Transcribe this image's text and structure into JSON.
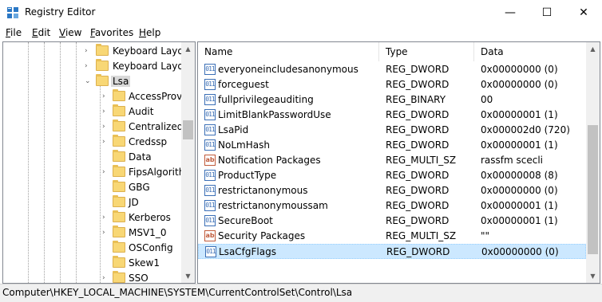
{
  "window": {
    "title": "Registry Editor",
    "minimize_glyph": "—",
    "maximize_glyph": "☐",
    "close_glyph": "✕"
  },
  "menu": [
    {
      "label": "File",
      "underline": "F",
      "rest": "ile"
    },
    {
      "label": "Edit",
      "underline": "E",
      "rest": "dit"
    },
    {
      "label": "View",
      "underline": "V",
      "rest": "iew"
    },
    {
      "label": "Favorites",
      "underline": "F",
      "rest": "avorites"
    },
    {
      "label": "Help",
      "underline": "H",
      "rest": "elp"
    }
  ],
  "tree": {
    "items": [
      {
        "label": "Keyboard Layou",
        "expander": "›"
      },
      {
        "label": "Keyboard Layou",
        "expander": "›"
      },
      {
        "label": "Lsa",
        "expander": "⌄",
        "selected": true
      },
      {
        "label": "AccessProvid",
        "expander": "›"
      },
      {
        "label": "Audit",
        "expander": "›"
      },
      {
        "label": "CentralizedA",
        "expander": "›"
      },
      {
        "label": "Credssp",
        "expander": "›"
      },
      {
        "label": "Data",
        "expander": ""
      },
      {
        "label": "FipsAlgorith",
        "expander": "›"
      },
      {
        "label": "GBG",
        "expander": ""
      },
      {
        "label": "JD",
        "expander": ""
      },
      {
        "label": "Kerberos",
        "expander": "›"
      },
      {
        "label": "MSV1_0",
        "expander": "›"
      },
      {
        "label": "OSConfig",
        "expander": ""
      },
      {
        "label": "Skew1",
        "expander": ""
      },
      {
        "label": "SSO",
        "expander": "›"
      }
    ]
  },
  "list": {
    "columns": {
      "name": "Name",
      "type": "Type",
      "data": "Data"
    },
    "rows": [
      {
        "name": "everyoneincludesanonymous",
        "type": "REG_DWORD",
        "data": "0x00000000 (0)",
        "icon": "binary-value-icon",
        "icon_text": "011"
      },
      {
        "name": "forceguest",
        "type": "REG_DWORD",
        "data": "0x00000000 (0)",
        "icon": "binary-value-icon",
        "icon_text": "011"
      },
      {
        "name": "fullprivilegeauditing",
        "type": "REG_BINARY",
        "data": "00",
        "icon": "binary-value-icon",
        "icon_text": "011"
      },
      {
        "name": "LimitBlankPasswordUse",
        "type": "REG_DWORD",
        "data": "0x00000001 (1)",
        "icon": "binary-value-icon",
        "icon_text": "011"
      },
      {
        "name": "LsaPid",
        "type": "REG_DWORD",
        "data": "0x000002d0 (720)",
        "icon": "binary-value-icon",
        "icon_text": "011"
      },
      {
        "name": "NoLmHash",
        "type": "REG_DWORD",
        "data": "0x00000001 (1)",
        "icon": "binary-value-icon",
        "icon_text": "011"
      },
      {
        "name": "Notification Packages",
        "type": "REG_MULTI_SZ",
        "data": "rassfm scecli",
        "icon": "string-value-icon",
        "icon_text": "ab"
      },
      {
        "name": "ProductType",
        "type": "REG_DWORD",
        "data": "0x00000008 (8)",
        "icon": "binary-value-icon",
        "icon_text": "011"
      },
      {
        "name": "restrictanonymous",
        "type": "REG_DWORD",
        "data": "0x00000000 (0)",
        "icon": "binary-value-icon",
        "icon_text": "011"
      },
      {
        "name": "restrictanonymoussam",
        "type": "REG_DWORD",
        "data": "0x00000001 (1)",
        "icon": "binary-value-icon",
        "icon_text": "011"
      },
      {
        "name": "SecureBoot",
        "type": "REG_DWORD",
        "data": "0x00000001 (1)",
        "icon": "binary-value-icon",
        "icon_text": "011"
      },
      {
        "name": "Security Packages",
        "type": "REG_MULTI_SZ",
        "data": "\"\"",
        "icon": "string-value-icon",
        "icon_text": "ab"
      },
      {
        "name": "LsaCfgFlags",
        "type": "REG_DWORD",
        "data": "0x00000000 (0)",
        "icon": "binary-value-icon",
        "icon_text": "011",
        "selected": true
      }
    ]
  },
  "status": {
    "path": "Computer\\HKEY_LOCAL_MACHINE\\SYSTEM\\CurrentControlSet\\Control\\Lsa"
  },
  "colors": {
    "selection": "#cce8ff",
    "folder": "#f8d775"
  }
}
